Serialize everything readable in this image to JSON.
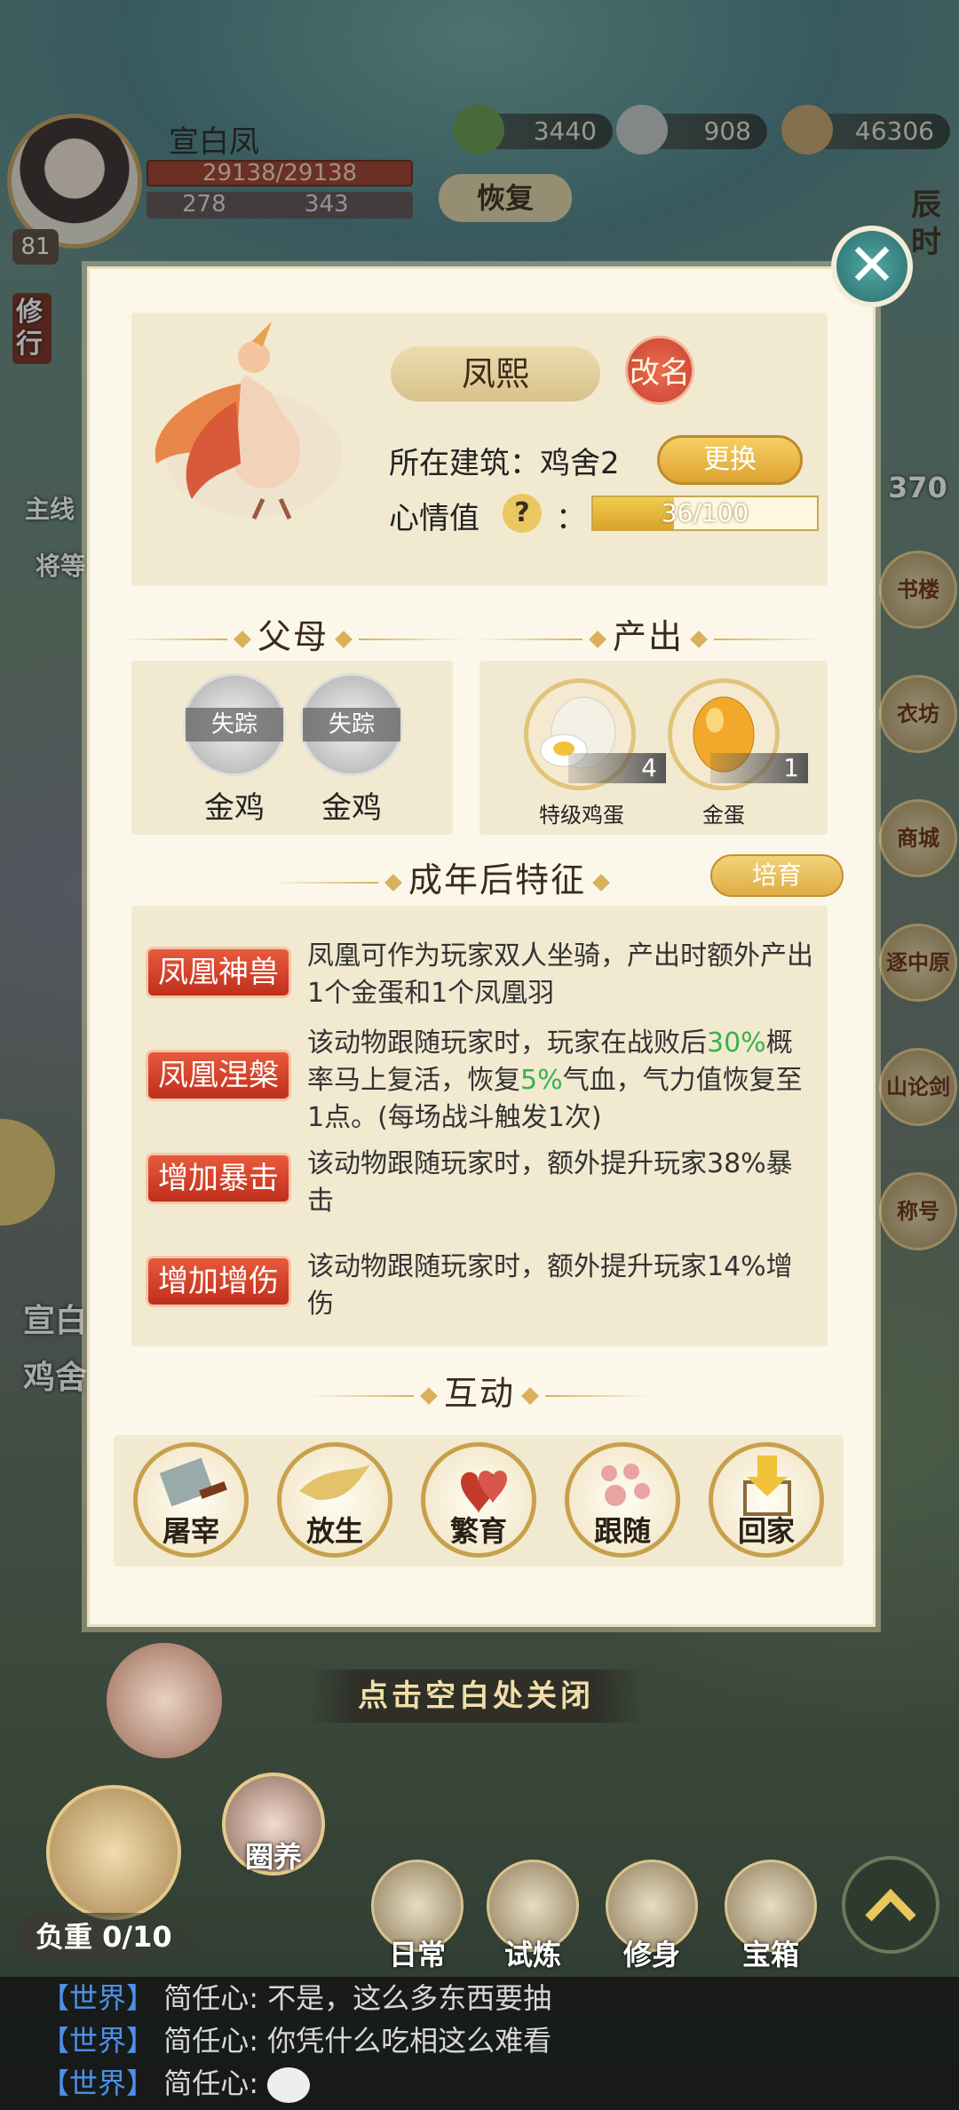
{
  "player": {
    "name": "宣白凤",
    "hp": "29138/29138",
    "stat1": "278",
    "stat2": "343",
    "level": "81"
  },
  "resources": [
    {
      "name": "green-currency",
      "value": "3440"
    },
    {
      "name": "silver-ingot",
      "value": "908"
    },
    {
      "name": "copper-coins",
      "value": "46306"
    }
  ],
  "recover_label": "恢复",
  "side_left": {
    "practice": "修行",
    "quest_main": "主线",
    "quest_sub": "将等",
    "bubble1": "宣白",
    "bubble2": "鸡舍"
  },
  "side_right": {
    "time": "辰时",
    "num": "370",
    "b1": "书楼",
    "b2": "衣坊",
    "b3": "商城",
    "b4": "逐中原",
    "b5": "山论剑",
    "b6": "称号"
  },
  "pet": {
    "name": "凤熙",
    "rename_label": "改名",
    "building_label": "所在建筑：",
    "building_value": "鸡舍2",
    "change_label": "更换",
    "mood_label": "心情值",
    "mood_colon": "：",
    "mood_text": "36/100",
    "mood_value": 36,
    "mood_max": 100
  },
  "sections": {
    "parents": "父母",
    "output": "产出",
    "traits": "成年后特征",
    "interact": "互动"
  },
  "parents": [
    {
      "status": "失踪",
      "name": "金鸡"
    },
    {
      "status": "失踪",
      "name": "金鸡"
    }
  ],
  "outputs": [
    {
      "name": "特级鸡蛋",
      "count": "4"
    },
    {
      "name": "金蛋",
      "count": "1"
    }
  ],
  "breed_label": "培育",
  "traits": [
    {
      "tag": "凤凰神兽",
      "text": "凤凰可作为玩家双人坐骑，产出时额外产出1个金蛋和1个凤凰羽"
    },
    {
      "tag": "凤凰涅槃",
      "text_a": "该动物跟随玩家时，玩家在战败后",
      "hl1": "30%",
      "text_b": "概率马上复活，恢复",
      "hl2": "5%",
      "text_c": "气血，气力值恢复至1点。(每场战斗触发1次)"
    },
    {
      "tag": "增加暴击",
      "text": "该动物跟随玩家时，额外提升玩家38%暴击"
    },
    {
      "tag": "增加增伤",
      "text": "该动物跟随玩家时，额外提升玩家14%增伤"
    }
  ],
  "actions": [
    "屠宰",
    "放生",
    "繁育",
    "跟随",
    "回家"
  ],
  "close_hint": "点击空白处关闭",
  "bottom": {
    "load": "负重 0/10",
    "pen": "圈养",
    "nav": [
      "日常",
      "试炼",
      "修身",
      "宝箱"
    ]
  },
  "chat": [
    {
      "channel": "【世界】",
      "text": "简任心: 不是，这么多东西要抽"
    },
    {
      "channel": "【世界】",
      "text": "简任心: 你凭什么吃相这么难看"
    },
    {
      "channel": "【世界】",
      "text": "简任心: "
    }
  ]
}
